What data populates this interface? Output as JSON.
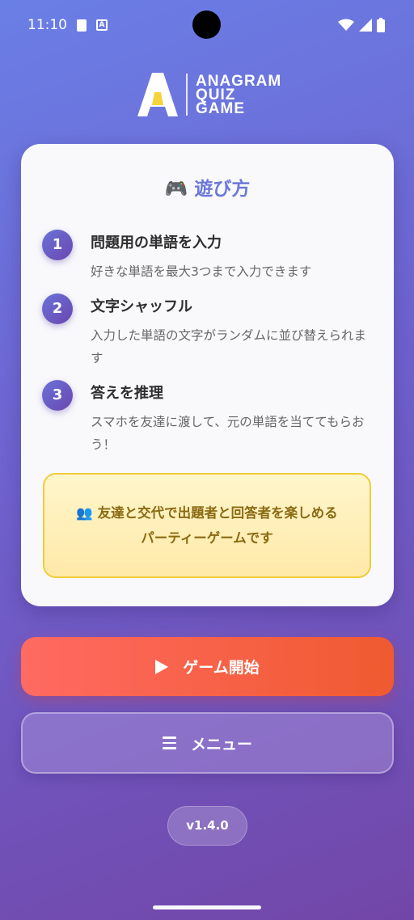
{
  "status_bar": {
    "time": "11:10",
    "icons": [
      "sd-card-icon",
      "a-badge-icon",
      "wifi-icon",
      "signal-icon",
      "battery-icon"
    ]
  },
  "logo": {
    "line1": "ANAGRAM",
    "line2": "QUIZ",
    "line3": "GAME",
    "accent_color": "#f6d33c"
  },
  "how_to": {
    "title": "🎮 遊び方",
    "steps": [
      {
        "number": "1",
        "title": "問題用の単語を入力",
        "desc": "好きな単語を最大3つまで入力できます"
      },
      {
        "number": "2",
        "title": "文字シャッフル",
        "desc": "入力した単語の文字がランダムに並び替えられます"
      },
      {
        "number": "3",
        "title": "答えを推理",
        "desc": "スマホを友達に渡して、元の単語を当ててもらおう！"
      }
    ],
    "notice_line1": "友達と交代で出題者と回答者を楽しめる",
    "notice_line2": "パーティーゲームです",
    "notice_icon": "people-icon"
  },
  "buttons": {
    "start_label": "ゲーム開始",
    "start_icon": "play-icon",
    "menu_label": "メニュー",
    "menu_icon": "hamburger-icon"
  },
  "version": "v1.4.0",
  "colors": {
    "title_accent": "#6b78d9",
    "start_gradient": [
      "#ff6a62",
      "#f05a30"
    ],
    "notice_border": "#f1cd3b"
  }
}
